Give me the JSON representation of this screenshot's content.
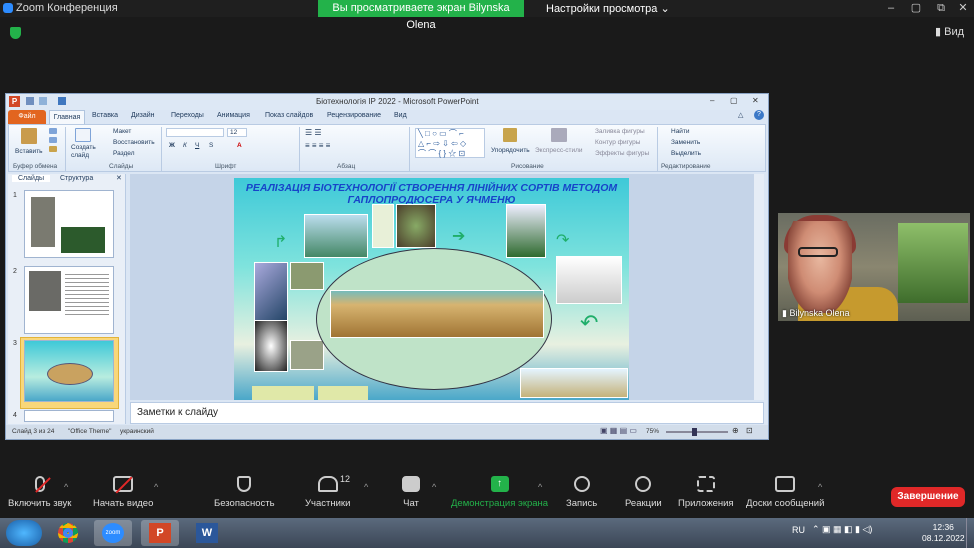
{
  "zoom": {
    "window_title": "Zoom Конференция",
    "share_banner": "Вы просматриваете экран Bilynska Olena",
    "view_settings": "Настройки просмотра",
    "view_button": "Вид",
    "end_button": "Завершение",
    "participant_name": "Bilynska Olena",
    "toolbar": {
      "mute": "Включить звук",
      "video": "Начать видео",
      "security": "Безопасность",
      "participants": "Участники",
      "participants_count": "12",
      "chat": "Чат",
      "share": "Демонстрация экрана",
      "record": "Запись",
      "reactions": "Реакции",
      "apps": "Приложения",
      "whiteboards": "Доски сообщений"
    }
  },
  "ppt": {
    "title": "Біотехнологія ІР 2022  -  Microsoft PowerPoint",
    "tabs": [
      "Файл",
      "Главная",
      "Вставка",
      "Дизайн",
      "Переходы",
      "Анимация",
      "Показ слайдов",
      "Рецензирование",
      "Вид"
    ],
    "ribbon": {
      "paste": "Вставить",
      "clipboard": "Буфер обмена",
      "new_slide": "Создать слайд",
      "layout": "Макет",
      "reset": "Восстановить",
      "section": "Раздел",
      "slides_group": "Слайды",
      "font_size": "12",
      "font_group": "Шрифт",
      "paragraph_group": "Абзац",
      "arrange": "Упорядочить",
      "quick_styles": "Экспресс-стили",
      "shape_fill": "Заливка фигуры",
      "shape_outline": "Контур фигуры",
      "shape_effects": "Эффекты фигуры",
      "drawing_group": "Рисование",
      "find": "Найти",
      "replace": "Заменить",
      "select": "Выделить",
      "editing_group": "Редактирование"
    },
    "pane_tabs": [
      "Слайды",
      "Структура"
    ],
    "thumb_numbers": [
      "1",
      "2",
      "3",
      "4"
    ],
    "slide_title": "РЕАЛІЗАЦІЯ БІОТЕХНОЛОГІЇ СТВОРЕННЯ ЛІНІЙНИХ СОРТІВ МЕТОДОМ ГАПЛОПРОДЮСЕРА У ЯЧМЕНЮ",
    "notes_placeholder": "Заметки к слайду",
    "status": {
      "slide": "Слайд 3 из 24",
      "theme": "\"Office Theme\"",
      "language": "украинский",
      "zoom": "75%"
    }
  },
  "taskbar": {
    "lang": "RU",
    "time": "12:36",
    "date": "08.12.2022",
    "zoom_label": "zoom"
  }
}
